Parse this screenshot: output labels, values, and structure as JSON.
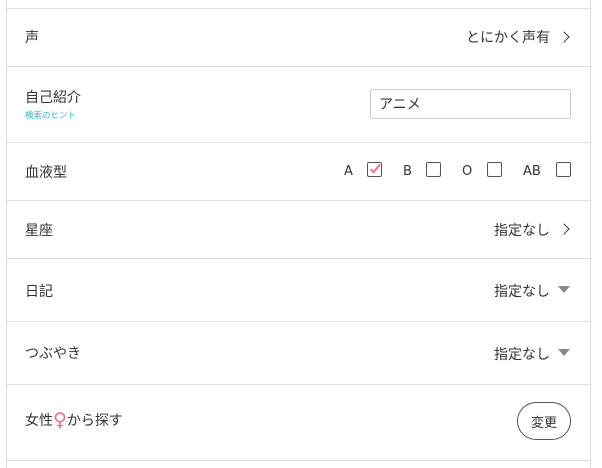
{
  "rows": {
    "voice": {
      "label": "声",
      "value": "とにかく声有"
    },
    "intro": {
      "label": "自己紹介",
      "hint": "検索のヒント",
      "input_value": "アニメ"
    },
    "blood": {
      "label": "血液型",
      "options": [
        {
          "label": "A",
          "checked": true
        },
        {
          "label": "B",
          "checked": false
        },
        {
          "label": "O",
          "checked": false
        },
        {
          "label": "AB",
          "checked": false
        }
      ]
    },
    "zodiac": {
      "label": "星座",
      "value": "指定なし"
    },
    "diary": {
      "label": "日記",
      "value": "指定なし"
    },
    "tweet": {
      "label": "つぶやき",
      "value": "指定なし"
    },
    "gender": {
      "label_prefix": "女性",
      "icon": "♀",
      "label_suffix": "から探す",
      "button": "変更"
    }
  },
  "colors": {
    "hint": "#33b5c9",
    "check": "#e8728a",
    "female_icon": "#e8728a",
    "divider": "#dddddd"
  }
}
